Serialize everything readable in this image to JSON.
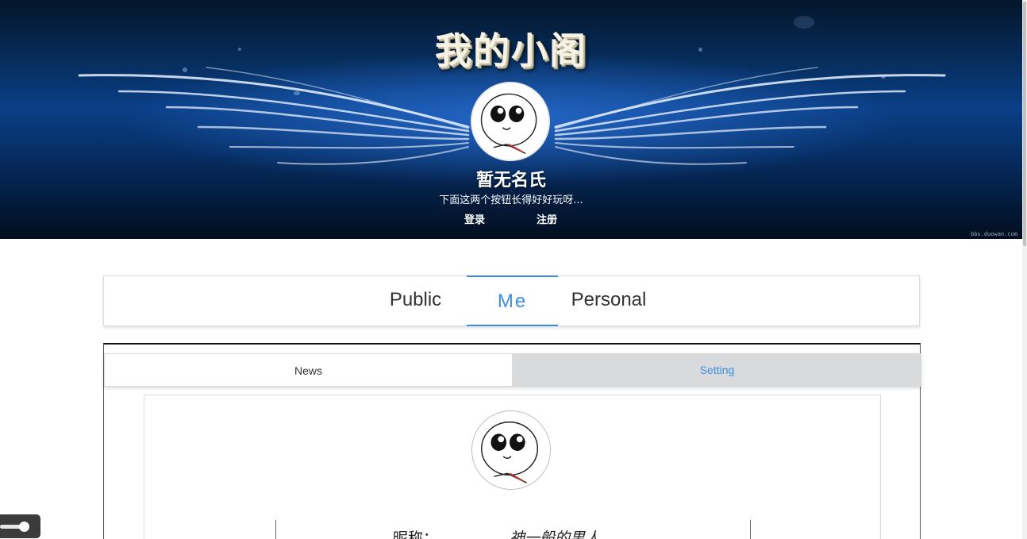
{
  "header": {
    "site_title": "我的小阁",
    "user_name": "暂无名氏",
    "bio": "下面这两个按钮长得好好玩呀...",
    "login_label": "登录",
    "register_label": "注册",
    "watermark": "bbs.duowan.com",
    "avatar_icon": "cartoon-face-avatar"
  },
  "nav": {
    "tabs": [
      {
        "label": "Public"
      },
      {
        "label": "Me"
      },
      {
        "label": "Personal"
      }
    ],
    "active_tab": "Me",
    "accent_color": "#3a8ee6"
  },
  "sub_tabs": {
    "tabs": [
      {
        "label": "News"
      },
      {
        "label": "Setting"
      }
    ],
    "active_tab": "Setting"
  },
  "profile": {
    "avatar_icon": "cartoon-face-avatar",
    "nickname_label": "昵称：",
    "nickname_value": "神一般的男人"
  },
  "float_toggle": {
    "icon": "toggle-slider-icon"
  }
}
